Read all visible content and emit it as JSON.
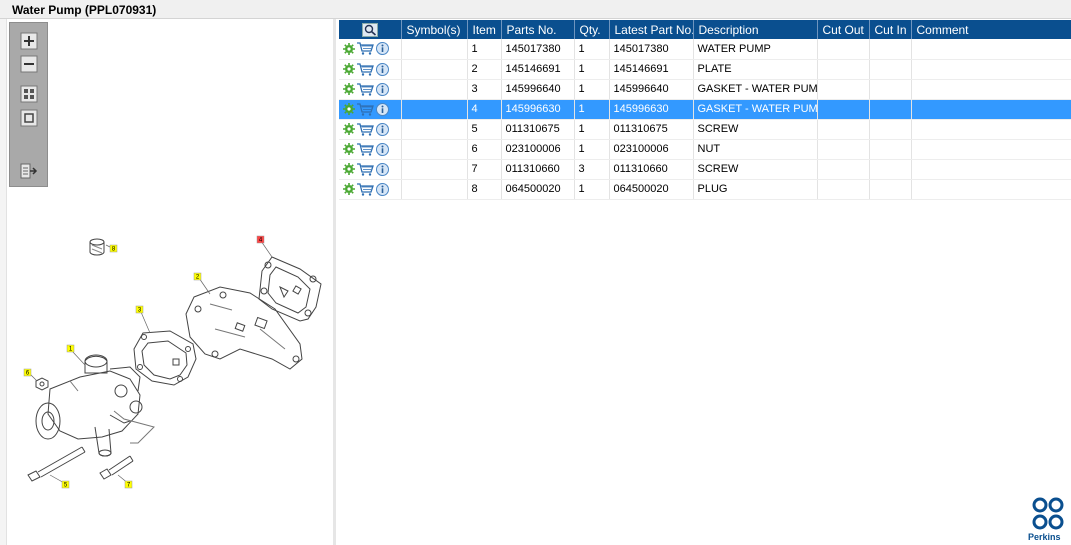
{
  "window": {
    "title": "Water Pump (PPL070931)"
  },
  "toolbar": {
    "buttons": [
      {
        "name": "zoom-in-icon"
      },
      {
        "name": "zoom-out-icon"
      },
      {
        "name": "fit-all-icon"
      },
      {
        "name": "fit-window-icon"
      },
      {
        "name": "export-icon"
      }
    ]
  },
  "drawing": {
    "callouts": [
      "1",
      "2",
      "3",
      "4",
      "5",
      "6",
      "7",
      "8"
    ],
    "highlighted_callout": "4"
  },
  "table": {
    "columns": [
      "Symbol(s)",
      "Item",
      "Parts No.",
      "Qty.",
      "Latest Part No.",
      "Description",
      "Cut Out",
      "Cut In",
      "Comment"
    ],
    "rows": [
      {
        "symbols": "",
        "item": "1",
        "part_no": "145017380",
        "qty": "1",
        "latest": "145017380",
        "desc": "WATER PUMP",
        "cut_out": "",
        "cut_in": "",
        "comment": ""
      },
      {
        "symbols": "",
        "item": "2",
        "part_no": "145146691",
        "qty": "1",
        "latest": "145146691",
        "desc": "PLATE",
        "cut_out": "",
        "cut_in": "",
        "comment": ""
      },
      {
        "symbols": "",
        "item": "3",
        "part_no": "145996640",
        "qty": "1",
        "latest": "145996640",
        "desc": "GASKET - WATER PUMP",
        "cut_out": "",
        "cut_in": "",
        "comment": ""
      },
      {
        "symbols": "",
        "item": "4",
        "part_no": "145996630",
        "qty": "1",
        "latest": "145996630",
        "desc": "GASKET - WATER PUMP",
        "cut_out": "",
        "cut_in": "",
        "comment": ""
      },
      {
        "symbols": "",
        "item": "5",
        "part_no": "011310675",
        "qty": "1",
        "latest": "011310675",
        "desc": "SCREW",
        "cut_out": "",
        "cut_in": "",
        "comment": ""
      },
      {
        "symbols": "",
        "item": "6",
        "part_no": "023100006",
        "qty": "1",
        "latest": "023100006",
        "desc": "NUT",
        "cut_out": "",
        "cut_in": "",
        "comment": ""
      },
      {
        "symbols": "",
        "item": "7",
        "part_no": "011310660",
        "qty": "3",
        "latest": "011310660",
        "desc": "SCREW",
        "cut_out": "",
        "cut_in": "",
        "comment": ""
      },
      {
        "symbols": "",
        "item": "8",
        "part_no": "064500020",
        "qty": "1",
        "latest": "064500020",
        "desc": "PLUG",
        "cut_out": "",
        "cut_in": "",
        "comment": ""
      }
    ],
    "selected_row": 4
  },
  "brand": {
    "name": "Perkins",
    "color": "#0a4f8f"
  },
  "colors": {
    "header": "#0a4f8f",
    "selection": "#3399ff",
    "callout": "#ffff00",
    "callout_selected": "#ff4444"
  }
}
